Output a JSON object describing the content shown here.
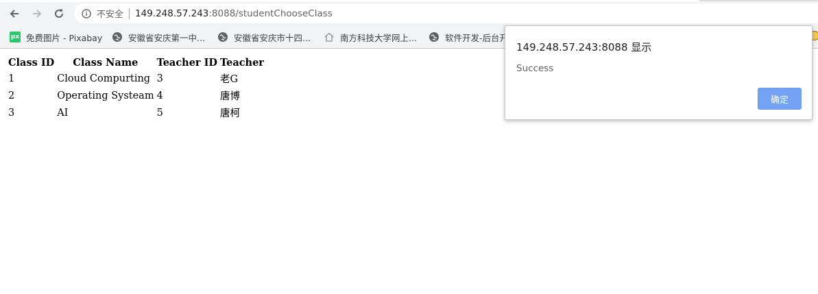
{
  "browser": {
    "security_label": "不安全",
    "url_host": "149.248.57.243",
    "url_rest": ":8088/studentChooseClass",
    "bookmarks": [
      {
        "label": "免费图片 - Pixabay",
        "icon": "pixabay-icon"
      },
      {
        "label": "安徽省安庆第一中...",
        "icon": "globe-icon"
      },
      {
        "label": "安徽省安庆市十四...",
        "icon": "globe-icon"
      },
      {
        "label": "南方科技大学网上...",
        "icon": "home-icon"
      },
      {
        "label": "软件开发-后台开",
        "icon": "globe-icon"
      }
    ]
  },
  "table": {
    "headers": [
      "Class ID",
      "Class Name",
      "Teacher ID",
      "Teacher"
    ],
    "rows": [
      [
        "1",
        "Cloud Compurting",
        "3",
        "老G"
      ],
      [
        "2",
        "Operating Systeam",
        "4",
        "唐博"
      ],
      [
        "3",
        "AI",
        "5",
        "唐柯"
      ]
    ]
  },
  "dialog": {
    "title": "149.248.57.243:8088 显示",
    "message": "Success",
    "ok_label": "确定"
  }
}
